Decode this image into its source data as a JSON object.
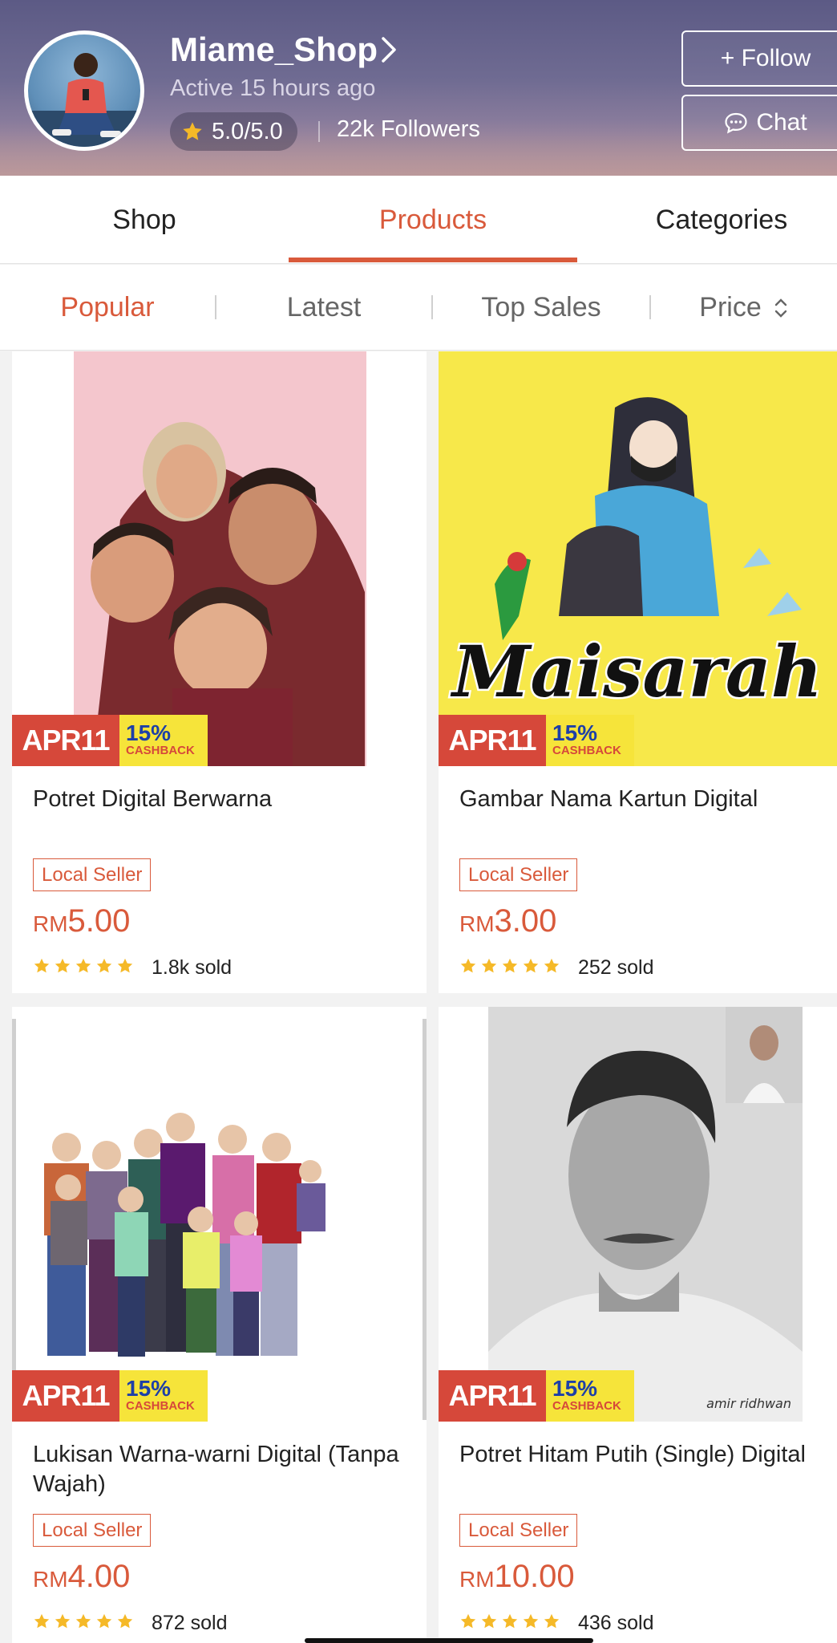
{
  "shop": {
    "name": "Miame_Shop",
    "active_text": "Active 15 hours ago",
    "rating": "5.0/5.0",
    "followers": "22k Followers",
    "follow_label": "+ Follow",
    "chat_label": "Chat"
  },
  "tabs": [
    {
      "label": "Shop",
      "active": false
    },
    {
      "label": "Products",
      "active": true
    },
    {
      "label": "Categories",
      "active": false
    }
  ],
  "sort": [
    {
      "label": "Popular",
      "active": true
    },
    {
      "label": "Latest",
      "active": false
    },
    {
      "label": "Top Sales",
      "active": false
    },
    {
      "label": "Price",
      "active": false
    }
  ],
  "promo": {
    "date": "APR11",
    "percent": "15%",
    "cashback": "CASHBACK"
  },
  "products": [
    {
      "title": "Potret Digital Berwarna",
      "tag": "Local Seller",
      "currency": "RM",
      "price": "5.00",
      "rating": 5,
      "sold": "1.8k sold"
    },
    {
      "title": "Gambar Nama Kartun Digital",
      "tag": "Local Seller",
      "currency": "RM",
      "price": "3.00",
      "rating": 5,
      "sold": "252 sold",
      "image_text": "Maisarah"
    },
    {
      "title": "Lukisan Warna-warni Digital (Tanpa Wajah)",
      "tag": "Local Seller",
      "currency": "RM",
      "price": "4.00",
      "rating": 5,
      "sold": "872 sold"
    },
    {
      "title": "Potret Hitam Putih (Single) Digital",
      "tag": "Local Seller",
      "currency": "RM",
      "price": "10.00",
      "rating": 5,
      "sold": "436 sold",
      "image_text": "amir ridhwan"
    }
  ],
  "colors": {
    "accent": "#d95a3b",
    "star": "#f5b928",
    "promo_red": "#d6483a",
    "promo_yellow": "#f6e43a"
  }
}
